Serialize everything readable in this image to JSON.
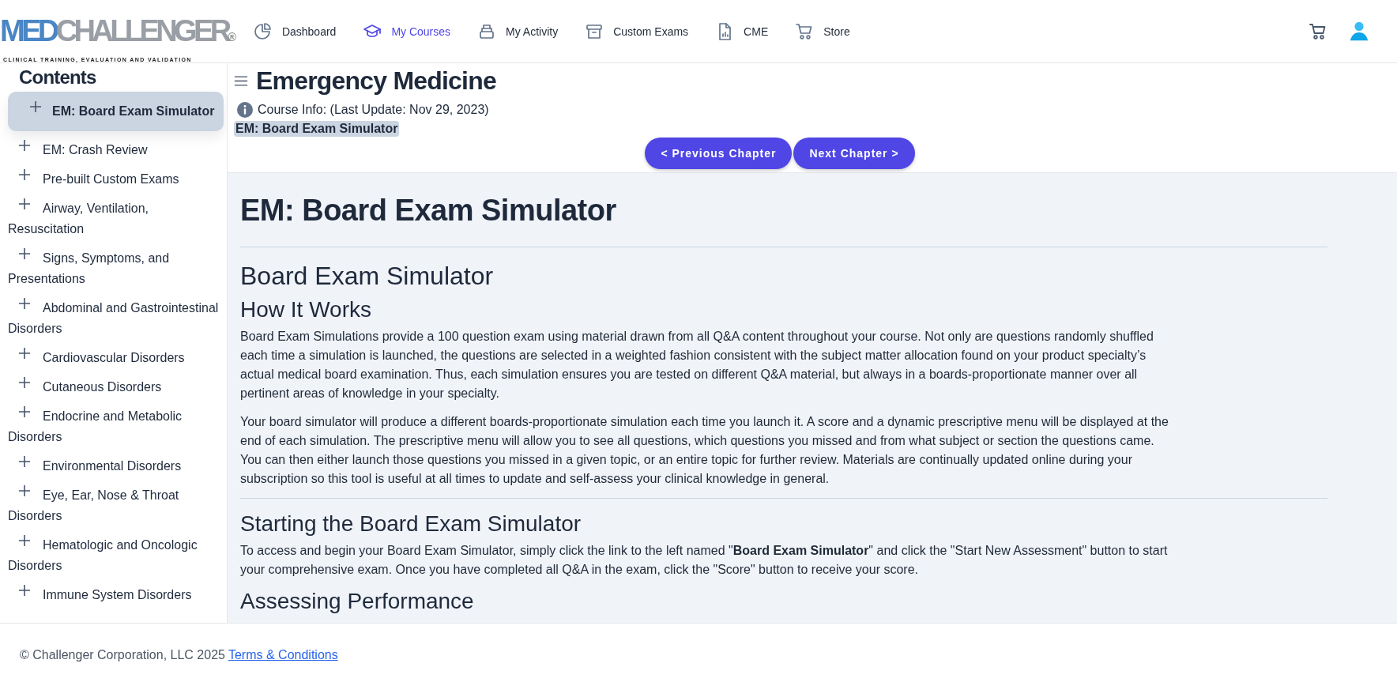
{
  "logo": {
    "brand_first": "MED",
    "brand_second": "CHALLENGER",
    "tagline": "CLINICAL TRAINING, EVALUATION AND VALIDATION",
    "mark": "®"
  },
  "nav": [
    {
      "label": "Dashboard",
      "selected": false
    },
    {
      "label": "My Courses",
      "selected": true
    },
    {
      "label": "My Activity",
      "selected": false
    },
    {
      "label": "Custom Exams",
      "selected": false
    },
    {
      "label": "CME",
      "selected": false
    },
    {
      "label": "Store",
      "selected": false
    }
  ],
  "sidebar": {
    "title": "Contents",
    "items": [
      {
        "label": "EM: Board Exam Simulator",
        "selected": true
      },
      {
        "label": "EM: Crash Review",
        "selected": false
      },
      {
        "label": "Pre-built Custom Exams",
        "selected": false
      },
      {
        "label": "Airway, Ventilation, Resuscitation",
        "selected": false
      },
      {
        "label": "Signs, Symptoms, and Presentations",
        "selected": false
      },
      {
        "label": "Abdominal and Gastrointestinal Disorders",
        "selected": false
      },
      {
        "label": "Cardiovascular Disorders",
        "selected": false
      },
      {
        "label": "Cutaneous Disorders",
        "selected": false
      },
      {
        "label": "Endocrine and Metabolic Disorders",
        "selected": false
      },
      {
        "label": "Environmental Disorders",
        "selected": false
      },
      {
        "label": "Eye, Ear, Nose & Throat Disorders",
        "selected": false
      },
      {
        "label": "Hematologic and Oncologic Disorders",
        "selected": false
      },
      {
        "label": "Immune System Disorders",
        "selected": false
      }
    ]
  },
  "course": {
    "title": "Emergency Medicine",
    "info": "Course Info: (Last Update: Nov 29, 2023)",
    "chapter_tag": "EM: Board Exam Simulator",
    "buttons": [
      "< Previous Chapter",
      "Next Chapter >"
    ]
  },
  "article": {
    "blocks": [
      {
        "kind": "h1",
        "text": "EM: Board Exam Simulator"
      },
      {
        "kind": "rule"
      },
      {
        "kind": "h2",
        "text": "Board Exam Simulator"
      },
      {
        "kind": "h3",
        "text": "How It Works"
      },
      {
        "kind": "p",
        "text": "Board Exam Simulations provide a 100 question exam using material drawn from all Q&A content throughout your course. Not only are questions randomly shuffled each time a simulation is launched, the questions are selected in a weighted fashion consistent with the subject matter allocation found on your product specialty’s actual medical board examination. Thus, each simulation ensures you are tested on different Q&A material, but always in a boards-proportionate manner over all pertinent areas of knowledge in your specialty."
      },
      {
        "kind": "p",
        "text": "Your board simulator will produce a different boards-proportionate simulation each time you launch it. A score and a dynamic prescriptive menu will be displayed at the end of each simulation. The prescriptive menu will allow you to see all questions, which questions you missed and from what subject or section the questions came. You can then either launch those questions you missed in a given topic, or an entire topic for further review. Materials are continually updated online during your subscription so this tool is useful at all times to update and self-assess your clinical knowledge in general."
      },
      {
        "kind": "rule"
      },
      {
        "kind": "h3",
        "text": "Starting the Board Exam Simulator"
      },
      {
        "kind": "p",
        "text": "To access and begin your Board Exam Simulator, simply click the link to the left named \"**Board Exam Simulator**\" and click the \"Start New Assessment\" button to start your comprehensive exam.  Once you have completed all Q&A in the exam, click the \"Score\" button to receive your score."
      },
      {
        "kind": "h3",
        "text": "Assessing Performance"
      }
    ]
  },
  "footer": {
    "copyright": "© Challenger Corporation, LLC 2025",
    "link": "Terms & Conditions"
  }
}
